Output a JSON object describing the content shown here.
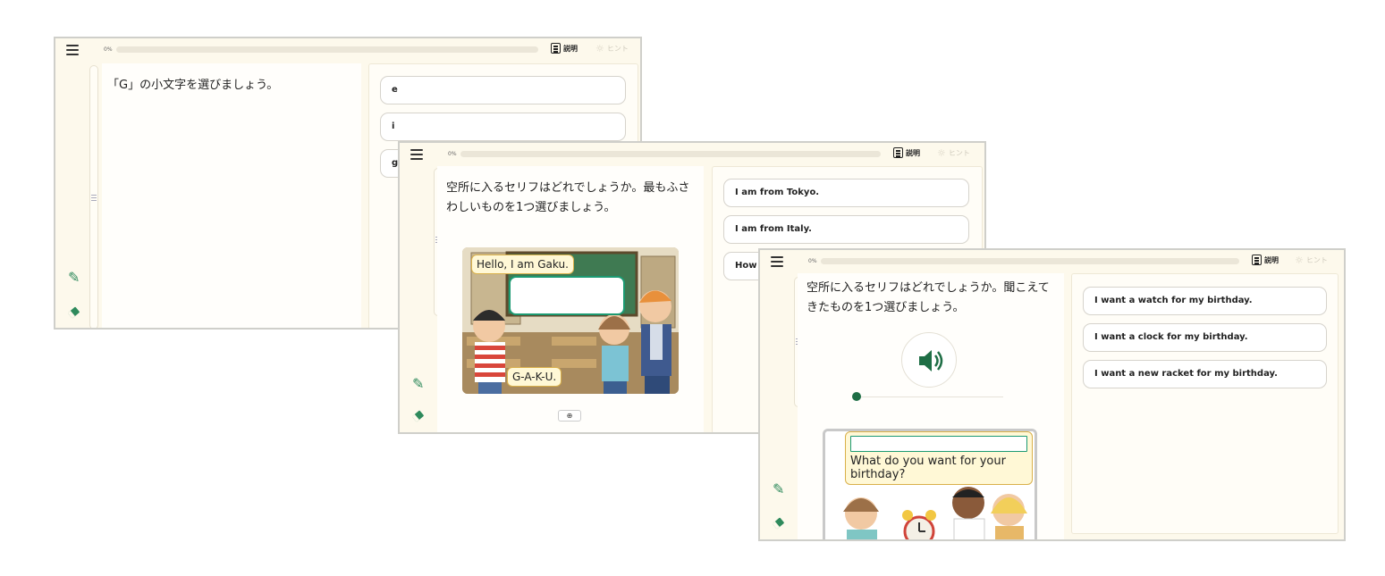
{
  "colors": {
    "accent": "#2e8a5c",
    "card_bg": "#fdf9ec",
    "bubble_border": "#d9b04a",
    "answer_box": "#1c9a72"
  },
  "common": {
    "progress_pct": "0%",
    "progress_value": 0,
    "description_label": "説明",
    "hint_label": "ヒント"
  },
  "screen1": {
    "question": "「G」の小文字を選びましょう。",
    "choices": [
      "e",
      "i",
      "g"
    ]
  },
  "screen2": {
    "question": "空所に入るセリフはどれでしょうか。最もふさわしいものを1つ選びましょう。",
    "choices": [
      "I am from Tokyo.",
      "I am from Italy.",
      "How"
    ],
    "bubble_top": "Hello, I am Gaku.",
    "bubble_bottom": "G-A-K-U."
  },
  "screen3": {
    "question": "空所に入るセリフはどれでしょうか。聞こえてきたものを1つ選びましょう。",
    "choices": [
      "I want a watch for my birthday.",
      "I want a clock for my birthday.",
      "I want a new racket for my birthday."
    ],
    "bubble_text": "What do you want for your birthday?",
    "audio_icon": "speaker-icon"
  }
}
